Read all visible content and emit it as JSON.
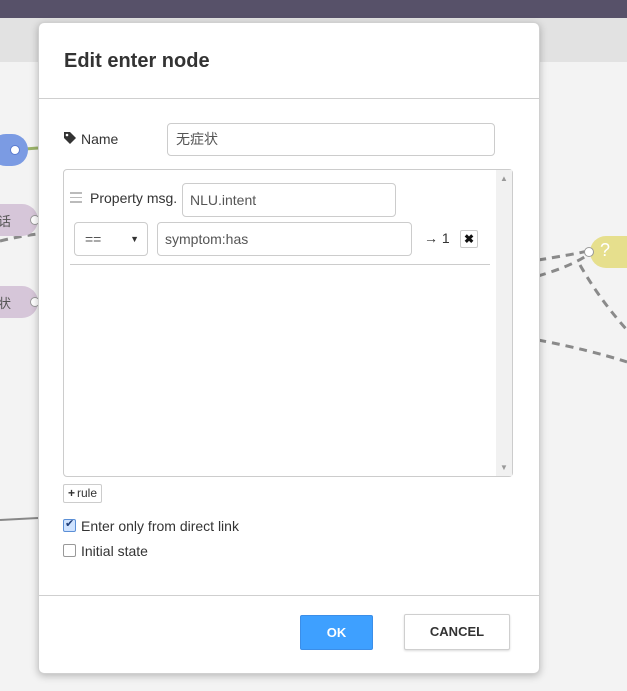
{
  "background": {
    "nodes": [
      {
        "label": ""
      },
      {
        "label": "话"
      },
      {
        "label": "状"
      },
      {
        "label": "?"
      }
    ],
    "colors": {
      "topbar": "#575169",
      "node_blue": "#7b9be3",
      "node_purple": "#d6c6d9",
      "node_yellow": "#e6df8d"
    }
  },
  "dialog": {
    "title": "Edit enter node",
    "name_field": {
      "label": "Name",
      "value": "无症状",
      "icon": "tag-icon"
    },
    "property": {
      "label": "Property",
      "prefix": "msg.",
      "value": "NLU.intent"
    },
    "rules": [
      {
        "operator": "==",
        "value": "symptom:has",
        "output": "→ 1",
        "delete_icon": "close-icon"
      }
    ],
    "add_rule_label": "rule",
    "options": [
      {
        "label": "Enter only from direct link",
        "checked": true
      },
      {
        "label": "Initial state",
        "checked": false
      }
    ],
    "buttons": {
      "ok": "OK",
      "cancel": "CANCEL"
    },
    "colors": {
      "ok_button": "#3ea0ff"
    }
  }
}
